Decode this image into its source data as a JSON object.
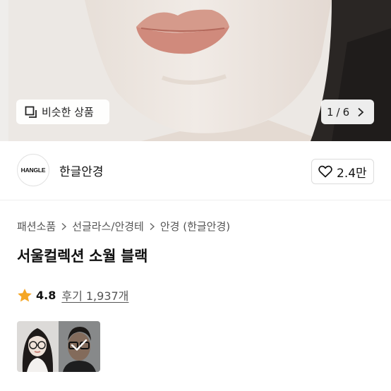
{
  "hero": {
    "similar_button_label": "비슷한 상품",
    "pager": {
      "current": "1",
      "separator": "/",
      "total": "6"
    }
  },
  "brand": {
    "logo_text": "HANGLE",
    "name": "한글안경",
    "like_count": "2.4만"
  },
  "breadcrumb": [
    "패션소품",
    "선글라스/안경테",
    "안경 (한글안경)"
  ],
  "product": {
    "title": "서울컬렉션 소월 블랙"
  },
  "rating": {
    "score": "4.8",
    "reviews_label": "후기 1,937개"
  },
  "colors": {
    "star": "#f5a623",
    "text": "#111111",
    "muted": "#555555"
  },
  "icons": {
    "similar": "copy-squares-icon",
    "pager_next": "chevron-right-icon",
    "like": "heart-outline-icon",
    "breadcrumb_separator": "chevron-right-icon",
    "rating": "star-icon",
    "selected_option": "check-icon"
  }
}
